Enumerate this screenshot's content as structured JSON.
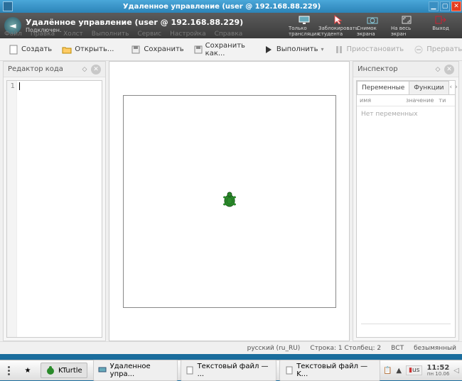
{
  "outer_window": {
    "title": "Удаленное управление (user @ 192.168.88.229)"
  },
  "remote_bar": {
    "title": "Удалённое управление (user @ 192.168.88.229)",
    "subtitle": "Подключен.",
    "tools": {
      "broadcast": "Только трансляция",
      "lock": "Заблокировать студента",
      "screenshot": "Снимок экрана",
      "fullscreen": "На весь экран",
      "exit": "Выход"
    },
    "ghost_menu": [
      "Файл",
      "Правка",
      "Холст",
      "Выполнить",
      "Сервис",
      "Настройка",
      "Справка"
    ]
  },
  "toolbar": {
    "new": "Создать",
    "open": "Открыть...",
    "save": "Сохранить",
    "saveas": "Сохранить как...",
    "run": "Выполнить",
    "pause": "Приостановить",
    "stop": "Прервать"
  },
  "editor": {
    "title": "Редактор кода",
    "line1": "1"
  },
  "inspector": {
    "title": "Инспектор",
    "tab_vars": "Переменные",
    "tab_funcs": "Функции",
    "col_name": "имя",
    "col_value": "значение",
    "col_type": "ти",
    "empty": "Нет переменных"
  },
  "statusbar": {
    "locale": "русский (ru_RU)",
    "pos": "Строка: 1 Столбец: 2",
    "ins": "ВСТ",
    "docname": "безымянный"
  },
  "taskbar": {
    "app": "KTurtle",
    "task_remote": "Удаленное упра...",
    "task_text1": "Текстовый файл — ...",
    "task_text2": "Текстовый файл — K...",
    "lang": "us",
    "time": "11:52",
    "date": "пн 10.06"
  }
}
